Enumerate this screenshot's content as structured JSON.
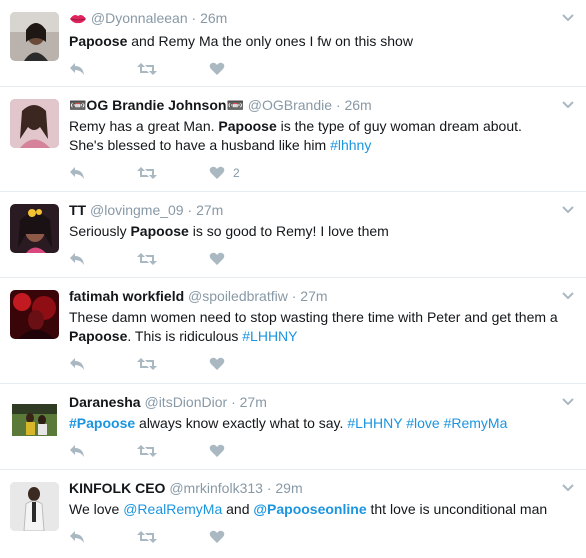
{
  "tweets": [
    {
      "name_emoji": "kiss-lips",
      "fullname": "",
      "handle": "@Dyonnaleean",
      "time": "26m",
      "text_parts": [
        "Papoose",
        " and Remy Ma the only ones I fw on this show"
      ],
      "like_count": ""
    },
    {
      "fullname": "📼OG Brandie Johnson📼",
      "handle": "@OGBrandie",
      "time": "26m",
      "text_parts": [
        "Remy has a great Man.  ",
        "Papoose",
        " is the type of guy woman dream about.",
        "She's blessed to have a husband like him ",
        "#lhhny"
      ],
      "like_count": "2"
    },
    {
      "fullname": "TT",
      "handle": "@lovingme_09",
      "time": "27m",
      "text_parts": [
        "Seriously ",
        "Papoose",
        " is so good to Remy! I love them"
      ],
      "like_count": ""
    },
    {
      "fullname": "fatimah workfield",
      "handle": "@spoiledbratfiw",
      "time": "27m",
      "text_parts": [
        "These damn women need to stop wasting there time with Peter and get them a",
        "Papoose",
        ". This is ridiculous ",
        "#LHHNY"
      ],
      "like_count": ""
    },
    {
      "fullname": "Daranesha",
      "handle": "@itsDionDior",
      "time": "27m",
      "text_parts": [
        "#Papoose",
        " always know exactly what to say. ",
        "#LHHNY",
        " ",
        "#love",
        " ",
        "#RemyMa"
      ],
      "like_count": ""
    },
    {
      "fullname": "KINFOLK CEO",
      "handle": "@mrkinfolk313",
      "time": "29m",
      "text_parts": [
        "We love ",
        "@RealRemyMa",
        " and ",
        "@Papooseonline",
        " tht love is unconditional man"
      ],
      "like_count": ""
    }
  ],
  "separator": "·",
  "icons": {
    "reply": "reply-icon",
    "retweet": "retweet-icon",
    "like": "heart-icon",
    "more": "chevron-down-icon"
  },
  "colors": {
    "link": "#1b95e0",
    "muted": "#8899a6",
    "icon": "#aab8c2",
    "divider": "#e6ecf0"
  }
}
